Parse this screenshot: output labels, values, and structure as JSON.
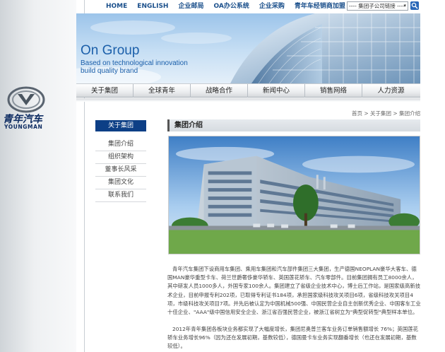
{
  "top_nav": {
    "links": [
      "HOME",
      "ENGLISH",
      "企业邮局",
      "OA办公系统",
      "企业采购",
      "青年车经销商加盟"
    ],
    "company_select": "---- 集团子公司链接 ----"
  },
  "logo": {
    "name_cn": "青年汽车",
    "name_en": "YOUNGMAN"
  },
  "banner": {
    "title": "On Group",
    "subtitle_line1": "Based on technological innovation",
    "subtitle_line2": "build quality brand"
  },
  "main_nav": {
    "items": [
      "关于集团",
      "全球青年",
      "战略合作",
      "新闻中心",
      "销售网络",
      "人力资源"
    ]
  },
  "breadcrumb": "首页 > 关于集团 > 集团介绍",
  "sidebar": {
    "active": "关于集团",
    "items": [
      "集团介绍",
      "组织架构",
      "董事长风采",
      "集团文化",
      "联系我们"
    ]
  },
  "content": {
    "title": "集团介绍",
    "paragraph1": "青年汽车集团下设商用车集团、乘用车集团和汽车部件集团三大集团，生产德国NEOPLAN豪华大客车、德国MAN豪华重型卡车、荷兰世爵奢侈豪华轿车、英国莲花轿车、汽车零部件。目前集团拥有员工8000余人，其中研发人员1000多人，外国专家100余人。集团建立了省级企业技术中心，博士后工作站，是国家级高新技术企业，目前申报专利202项，已取得专利证书184项，承担国家级科技攻关项目6项，省级科技攻关项目4项，市级科技攻关项目7项。并先后被认定为中国机械500强、中国民营企业自主创新优秀企业、中国客车工业十佳企业、\"AAA\"级中国信用安全企业、浙江省百强民营企业，被浙江省树立为\"典型促转型\"典型样本单位。",
    "paragraph2": "2012年青年集团各板块业务都实现了大幅度增长，集团尼奥普兰客车业务订单销售额增长 76%；英国莲花轿车业务增长96%（因为还在发展初期，基数较低），德国曼卡车业务实现翻番增长（也还在发展初期，基数较低）。"
  },
  "colors": {
    "brand_blue": "#0d3f86",
    "link_blue": "#1a4f8b",
    "banner_text": "#1b5faa"
  }
}
